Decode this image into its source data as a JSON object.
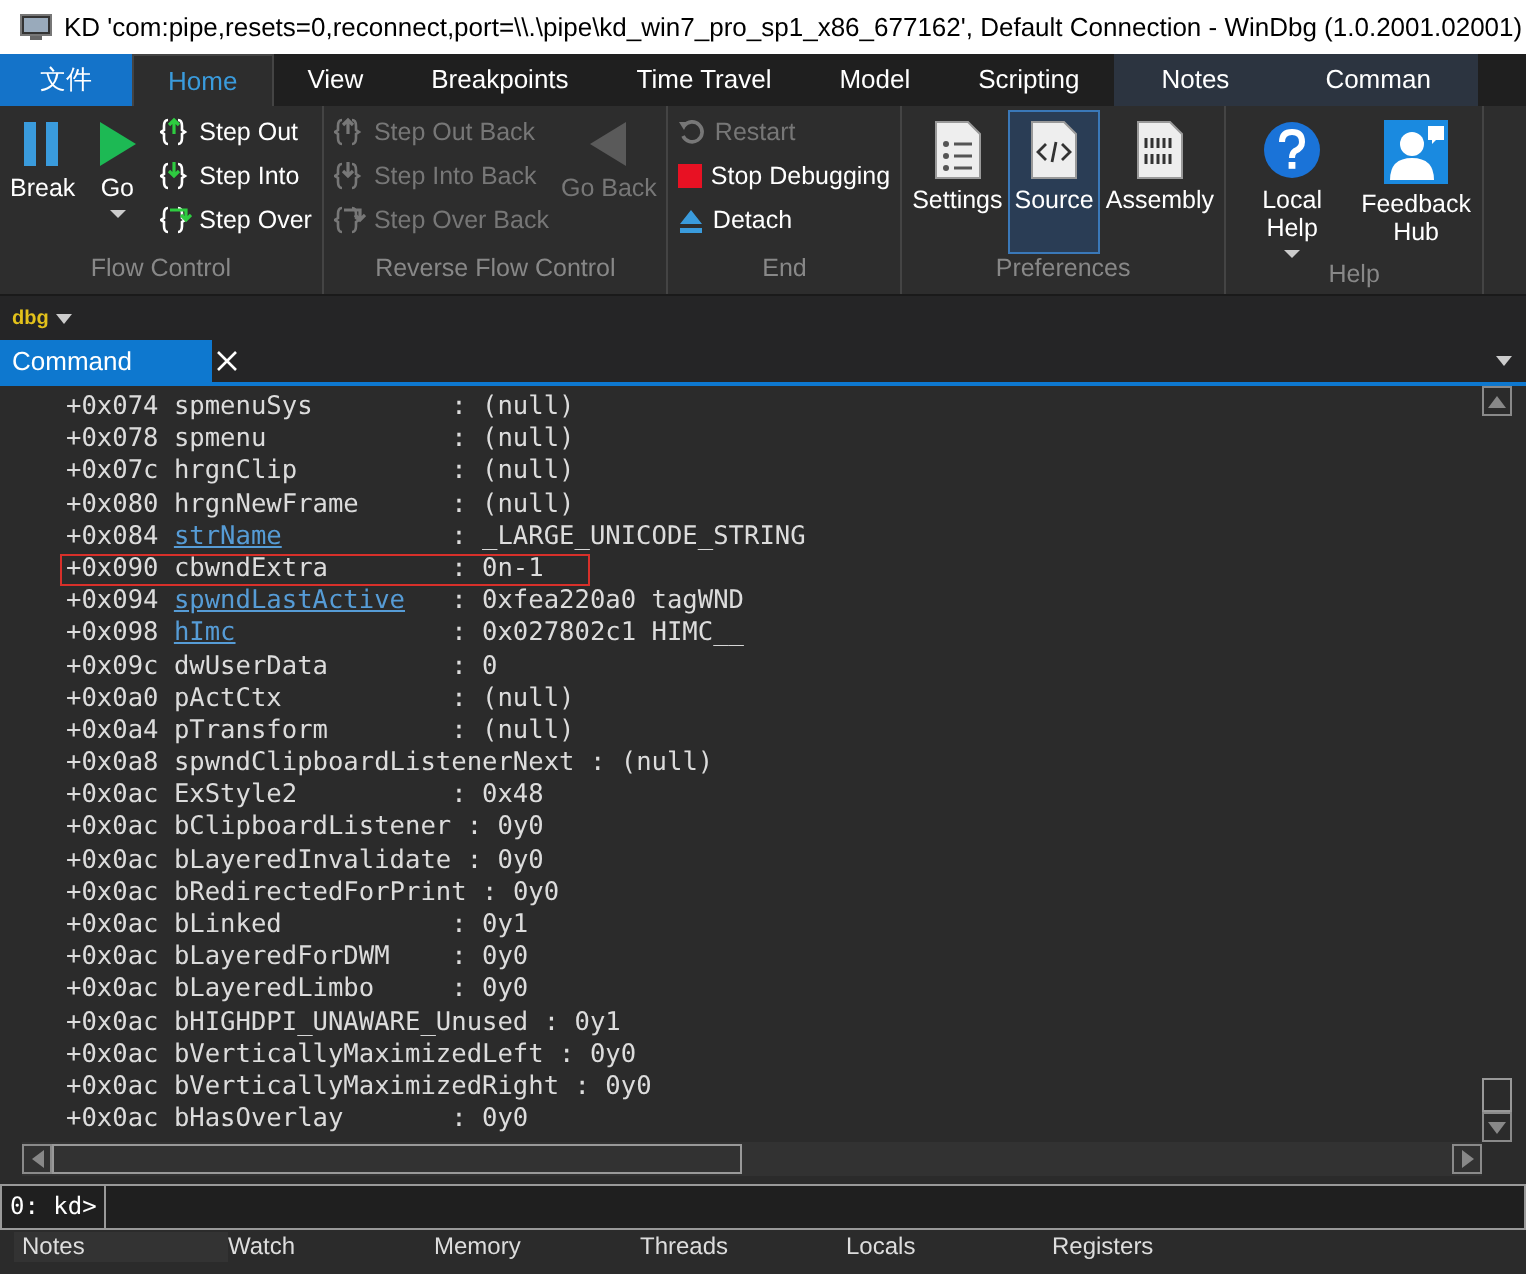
{
  "window": {
    "title": "KD 'com:pipe,resets=0,reconnect,port=\\\\.\\pipe\\kd_win7_pro_sp1_x86_677162', Default Connection  - WinDbg (1.0.2001.02001)"
  },
  "tabs": [
    {
      "label": "文件",
      "kind": "file",
      "selected": false
    },
    {
      "label": "Home",
      "kind": "normal",
      "selected": true
    },
    {
      "label": "View",
      "kind": "normal",
      "selected": false
    },
    {
      "label": "Breakpoints",
      "kind": "normal",
      "selected": false
    },
    {
      "label": "Time Travel",
      "kind": "normal",
      "selected": false
    },
    {
      "label": "Model",
      "kind": "normal",
      "selected": false
    },
    {
      "label": "Scripting",
      "kind": "normal",
      "selected": false
    },
    {
      "label": "Notes",
      "kind": "contextual",
      "selected": false
    },
    {
      "label": "Comman",
      "kind": "contextual",
      "selected": false
    }
  ],
  "ribbon": {
    "groups": [
      {
        "label": "Flow Control",
        "items": [
          {
            "label": "Break",
            "kind": "large",
            "disabled": false
          },
          {
            "label": "Go",
            "kind": "large",
            "disabled": false,
            "dropdown": true
          },
          {
            "label": "Step Out",
            "kind": "small",
            "disabled": false
          },
          {
            "label": "Step Into",
            "kind": "small",
            "disabled": false
          },
          {
            "label": "Step Over",
            "kind": "small",
            "disabled": false
          }
        ]
      },
      {
        "label": "Reverse Flow Control",
        "items": [
          {
            "label": "Step Out Back",
            "kind": "small",
            "disabled": true
          },
          {
            "label": "Step Into Back",
            "kind": "small",
            "disabled": true
          },
          {
            "label": "Step Over Back",
            "kind": "small",
            "disabled": true
          },
          {
            "label": "Go Back",
            "kind": "large",
            "disabled": true
          }
        ]
      },
      {
        "label": "End",
        "items": [
          {
            "label": "Restart",
            "kind": "small",
            "disabled": true
          },
          {
            "label": "Stop Debugging",
            "kind": "small",
            "disabled": false
          },
          {
            "label": "Detach",
            "kind": "small",
            "disabled": false
          }
        ]
      },
      {
        "label": "Preferences",
        "items": [
          {
            "label": "Settings",
            "kind": "large",
            "disabled": false,
            "selected": false
          },
          {
            "label": "Source",
            "kind": "large",
            "disabled": false,
            "selected": true
          },
          {
            "label": "Assembly",
            "kind": "large",
            "disabled": false,
            "selected": false
          }
        ]
      },
      {
        "label": "Help",
        "items": [
          {
            "label": "Local Help",
            "kind": "large",
            "disabled": false,
            "dropdown": true
          },
          {
            "label": "Feedback Hub",
            "kind": "large",
            "disabled": false
          }
        ]
      }
    ]
  },
  "context_bar": {
    "label": "dbg"
  },
  "panel": {
    "tab": "Command",
    "lines": [
      {
        "offset": "+0x074",
        "field": "spmenuSys",
        "link": false,
        "value": ": (null)",
        "highlighted": false
      },
      {
        "offset": "+0x078",
        "field": "spmenu",
        "link": false,
        "value": ": (null)",
        "highlighted": false
      },
      {
        "offset": "+0x07c",
        "field": "hrgnClip",
        "link": false,
        "value": ": (null)",
        "highlighted": false
      },
      {
        "offset": "+0x080",
        "field": "hrgnNewFrame",
        "link": false,
        "value": ": (null)",
        "highlighted": false
      },
      {
        "offset": "+0x084",
        "field": "strName",
        "link": true,
        "value": ": _LARGE_UNICODE_STRING",
        "highlighted": false
      },
      {
        "offset": "+0x090",
        "field": "cbwndExtra",
        "link": false,
        "value": ": 0n-1",
        "highlighted": true
      },
      {
        "offset": "+0x094",
        "field": "spwndLastActive",
        "link": true,
        "value": ": 0xfea220a0 tagWND",
        "highlighted": false
      },
      {
        "offset": "+0x098",
        "field": "hImc",
        "link": true,
        "value": ": 0x027802c1 HIMC__",
        "highlighted": false
      },
      {
        "offset": "+0x09c",
        "field": "dwUserData",
        "link": false,
        "value": ": 0",
        "highlighted": false
      },
      {
        "offset": "+0x0a0",
        "field": "pActCtx",
        "link": false,
        "value": ": (null)",
        "highlighted": false
      },
      {
        "offset": "+0x0a4",
        "field": "pTransform",
        "link": false,
        "value": ": (null)",
        "highlighted": false
      },
      {
        "offset": "+0x0a8",
        "field": "spwndClipboardListenerNext",
        "link": false,
        "value": ": (null)",
        "highlighted": false
      },
      {
        "offset": "+0x0ac",
        "field": "ExStyle2",
        "link": false,
        "value": ": 0x48",
        "highlighted": false
      },
      {
        "offset": "+0x0ac",
        "field": "bClipboardListener",
        "link": false,
        "value": ": 0y0",
        "highlighted": false
      },
      {
        "offset": "+0x0ac",
        "field": "bLayeredInvalidate",
        "link": false,
        "value": ": 0y0",
        "highlighted": false
      },
      {
        "offset": "+0x0ac",
        "field": "bRedirectedForPrint",
        "link": false,
        "value": ": 0y0",
        "highlighted": false
      },
      {
        "offset": "+0x0ac",
        "field": "bLinked",
        "link": false,
        "value": ": 0y1",
        "highlighted": false
      },
      {
        "offset": "+0x0ac",
        "field": "bLayeredForDWM",
        "link": false,
        "value": ": 0y0",
        "highlighted": false
      },
      {
        "offset": "+0x0ac",
        "field": "bLayeredLimbo",
        "link": false,
        "value": ": 0y0",
        "highlighted": false
      },
      {
        "offset": "+0x0ac",
        "field": "bHIGHDPI_UNAWARE_Unused",
        "link": false,
        "value": ": 0y1",
        "highlighted": false
      },
      {
        "offset": "+0x0ac",
        "field": "bVerticallyMaximizedLeft",
        "link": false,
        "value": ": 0y0",
        "highlighted": false
      },
      {
        "offset": "+0x0ac",
        "field": "bVerticallyMaximizedRight",
        "link": false,
        "value": ": 0y0",
        "highlighted": false
      },
      {
        "offset": "+0x0ac",
        "field": "bHasOverlay",
        "link": false,
        "value": ": 0y0",
        "highlighted": false
      }
    ],
    "prompt": "0: kd>"
  },
  "bottom_tabs": [
    {
      "label": "Notes",
      "selected": true
    },
    {
      "label": "Watch",
      "selected": false
    },
    {
      "label": "Memory",
      "selected": false
    },
    {
      "label": "Threads",
      "selected": false
    },
    {
      "label": "Locals",
      "selected": false
    },
    {
      "label": "Registers",
      "selected": false
    }
  ]
}
